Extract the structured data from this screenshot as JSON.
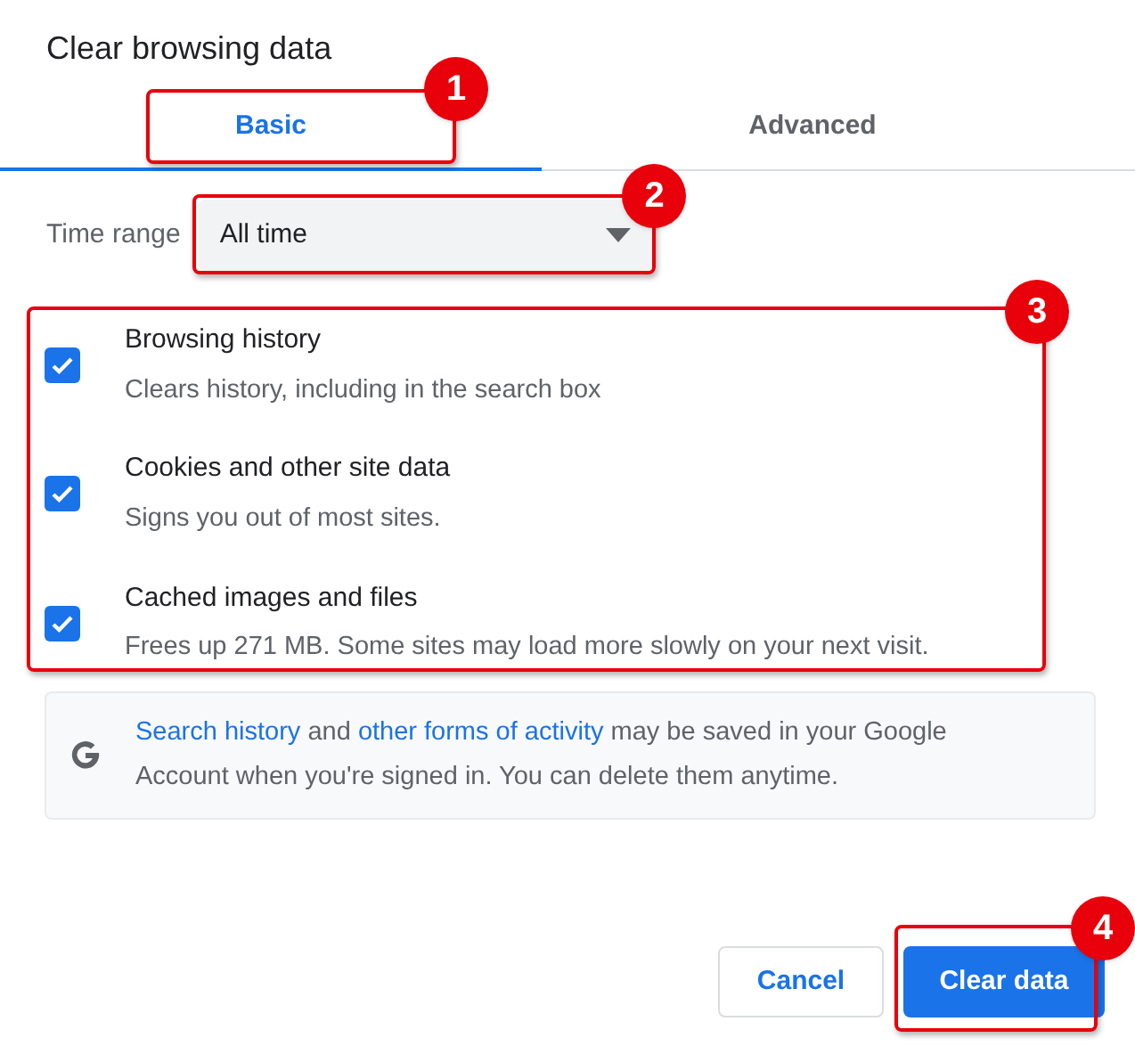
{
  "dialog": {
    "title": "Clear browsing data"
  },
  "tabs": [
    {
      "label": "Basic",
      "selected": true,
      "annotation": "1"
    },
    {
      "label": "Advanced",
      "selected": false
    }
  ],
  "time_range": {
    "label": "Time range",
    "value": "All time",
    "annotation": "2"
  },
  "options_annotation": "3",
  "options": [
    {
      "title": "Browsing history",
      "description": "Clears history, including in the search box",
      "checked": true
    },
    {
      "title": "Cookies and other site data",
      "description": "Signs you out of most sites.",
      "checked": true
    },
    {
      "title": "Cached images and files",
      "description": "Frees up 271 MB. Some sites may load more slowly on your next visit.",
      "checked": true
    }
  ],
  "notice": {
    "parts": [
      {
        "text": "Search history",
        "link": true
      },
      {
        "text": "and",
        "link": false
      },
      {
        "text": "other forms of activity",
        "link": true
      },
      {
        "text": "may be saved in your Google Account when you're signed in. You can delete them anytime.",
        "link": false
      }
    ]
  },
  "buttons": [
    {
      "label": "Cancel",
      "kind": "secondary"
    },
    {
      "label": "Clear data",
      "kind": "primary",
      "annotation": "4"
    }
  ]
}
